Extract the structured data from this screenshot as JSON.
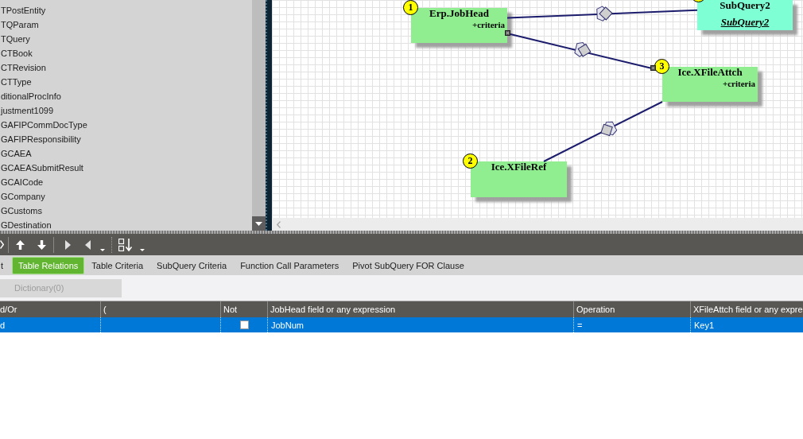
{
  "object_list": {
    "items": [
      {
        "label": "TPostEntity",
        "selected": false
      },
      {
        "label": "TQParam",
        "selected": false
      },
      {
        "label": "TQuery",
        "selected": false
      },
      {
        "label": "CTBook",
        "selected": false
      },
      {
        "label": "CTRevision",
        "selected": false
      },
      {
        "label": "CTType",
        "selected": false
      },
      {
        "label": "ditionalProcInfo",
        "selected": false
      },
      {
        "label": "justment1099",
        "selected": false
      },
      {
        "label": "GAFIPCommDocType",
        "selected": false
      },
      {
        "label": "GAFIPResponsibility",
        "selected": false
      },
      {
        "label": "GCAEA",
        "selected": false
      },
      {
        "label": "GCAEASubmitResult",
        "selected": false
      },
      {
        "label": "GCAICode",
        "selected": false
      },
      {
        "label": "GCompany",
        "selected": false
      },
      {
        "label": "GCustoms",
        "selected": false
      },
      {
        "label": "GDestination",
        "selected": false
      }
    ]
  },
  "diagram": {
    "tables": [
      {
        "kind": "table",
        "badge": "1",
        "title": "Erp.JobHead",
        "subtitle": "+criteria"
      },
      {
        "kind": "subquery",
        "title": "SubQuery2",
        "subtitle": "SubQuery2"
      },
      {
        "kind": "table",
        "badge": "3",
        "title": "Ice.XFileAttch",
        "subtitle": "+criteria"
      },
      {
        "kind": "table",
        "badge": "2",
        "title": "Ice.XFileRef"
      }
    ]
  },
  "tabs": [
    {
      "label": "t",
      "selected": false
    },
    {
      "label": "Table Relations",
      "selected": true
    },
    {
      "label": "Table Criteria",
      "selected": false
    },
    {
      "label": "SubQuery Criteria",
      "selected": false
    },
    {
      "label": "Function Call Parameters",
      "selected": false
    },
    {
      "label": "Pivot SubQuery FOR Clause",
      "selected": false
    }
  ],
  "dictionary_button": {
    "label": "Dictionary(0)",
    "disabled": true
  },
  "relations_table": {
    "columns": [
      "d/Or",
      "(",
      "Not",
      "JobHead field or any expression",
      "Operation",
      "XFileAttch field or any expre"
    ],
    "rows": [
      {
        "selected": true,
        "and_or": "d",
        "not_checked": false,
        "left_field": "JobNum",
        "operation": "=",
        "right_field": "Key1"
      }
    ]
  }
}
